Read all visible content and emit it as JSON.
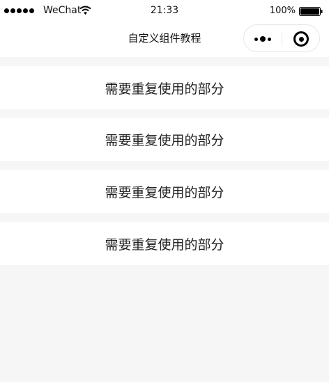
{
  "status_bar": {
    "carrier": "WeChat",
    "time": "21:33",
    "battery": "100%",
    "signal_icon": "signal-dots-icon",
    "wifi_icon": "wifi-icon",
    "battery_icon": "battery-icon"
  },
  "nav": {
    "title": "自定义组件教程",
    "more_icon": "more-dots-icon",
    "close_icon": "target-close-icon"
  },
  "items": [
    {
      "label": "需要重复使用的部分"
    },
    {
      "label": "需要重复使用的部分"
    },
    {
      "label": "需要重复使用的部分"
    },
    {
      "label": "需要重复使用的部分"
    }
  ],
  "colors": {
    "page_background": "#f6f6f6",
    "surface": "#ffffff",
    "text": "#111111"
  }
}
